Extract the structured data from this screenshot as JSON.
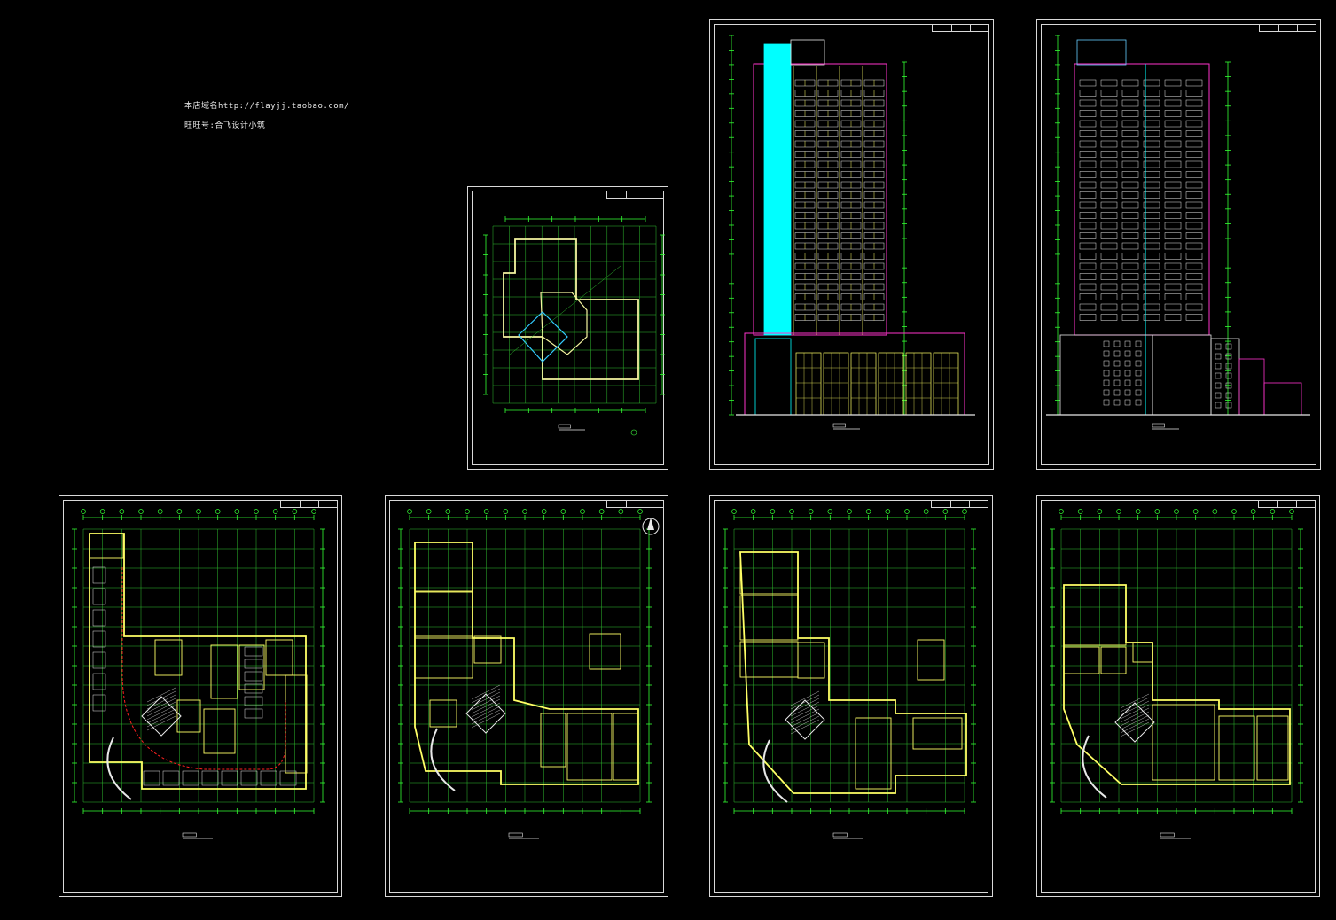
{
  "notes": {
    "line1": "本店域名http://flayjj.taobao.com/",
    "line2": "旺旺号:合飞设计小筑"
  },
  "colors": {
    "background": "#000000",
    "border": "#d9d9d9",
    "grid": "#2fbf2f",
    "dim": "#33ff33",
    "wall": "#ffff66",
    "cyan": "#00ffff",
    "magenta": "#ff33cc",
    "red": "#ff2020",
    "white": "#e8e8e8"
  },
  "sheets": [
    {
      "id": "roof-plan",
      "kind": "plan"
    },
    {
      "id": "elevation-front",
      "kind": "elevation"
    },
    {
      "id": "elevation-side",
      "kind": "elevation"
    },
    {
      "id": "basement-plan",
      "kind": "plan"
    },
    {
      "id": "first-floor-plan",
      "kind": "plan"
    },
    {
      "id": "second-floor-plan",
      "kind": "plan"
    },
    {
      "id": "third-floor-plan",
      "kind": "plan"
    }
  ]
}
